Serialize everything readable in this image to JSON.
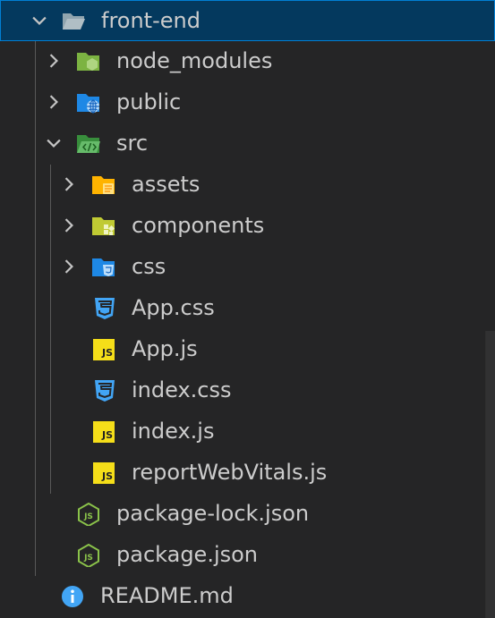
{
  "explorer": {
    "items": [
      {
        "label": "front-end",
        "icon": "folder-open-icon",
        "expanded": true,
        "selected": true
      },
      {
        "label": "node_modules",
        "icon": "folder-node-icon",
        "expanded": false
      },
      {
        "label": "public",
        "icon": "folder-public-icon",
        "expanded": false
      },
      {
        "label": "src",
        "icon": "folder-src-open-icon",
        "expanded": true
      },
      {
        "label": "assets",
        "icon": "folder-assets-icon",
        "expanded": false
      },
      {
        "label": "components",
        "icon": "folder-components-icon",
        "expanded": false
      },
      {
        "label": "css",
        "icon": "folder-css-icon",
        "expanded": false
      },
      {
        "label": "App.css",
        "icon": "css-file-icon"
      },
      {
        "label": "App.js",
        "icon": "js-file-icon"
      },
      {
        "label": "index.css",
        "icon": "css-file-icon"
      },
      {
        "label": "index.js",
        "icon": "js-file-icon"
      },
      {
        "label": "reportWebVitals.js",
        "icon": "js-file-icon"
      },
      {
        "label": "package-lock.json",
        "icon": "nodejs-file-icon"
      },
      {
        "label": "package.json",
        "icon": "nodejs-file-icon"
      },
      {
        "label": "README.md",
        "icon": "info-icon"
      }
    ],
    "js_badge_text": "JS"
  },
  "colors": {
    "background": "#252526",
    "selection_bg": "#04395e",
    "selection_border": "#007fd4",
    "folder_gray": "#90a4ae",
    "node_green": "#8bc34a",
    "public_blue": "#1e88e5",
    "src_green": "#4caf50",
    "assets_yellow": "#ffca28",
    "components_lime": "#c0ca33",
    "css_blue": "#42a5f5",
    "js_yellow": "#f5de19",
    "info_blue": "#42a5f5"
  }
}
